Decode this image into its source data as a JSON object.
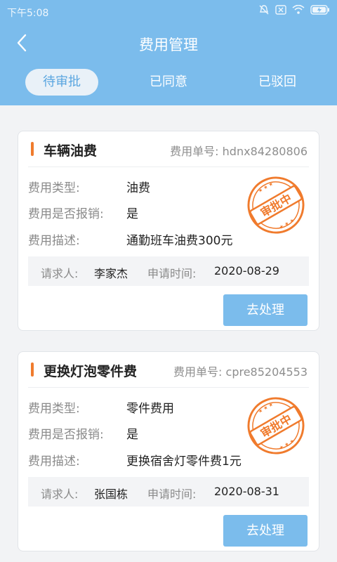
{
  "status": {
    "time": "下午5:08"
  },
  "header": {
    "title": "费用管理",
    "tabs": [
      {
        "label": "待审批",
        "active": true
      },
      {
        "label": "已同意",
        "active": false
      },
      {
        "label": "已驳回",
        "active": false
      }
    ]
  },
  "labels": {
    "expense_no": "费用单号:",
    "type": "费用类型:",
    "reimburse": "费用是否报销:",
    "description": "费用描述:",
    "requester": "请求人:",
    "apply_time": "申请时间:",
    "process_button": "去处理"
  },
  "cards": [
    {
      "title": "车辆油费",
      "expense_no": "hdnx84280806",
      "type": "油费",
      "reimburse": "是",
      "description": "通勤班车油费300元",
      "requester": "李家杰",
      "apply_time": "2020-08-29",
      "stamp": "审批中"
    },
    {
      "title": "更换灯泡零件费",
      "expense_no": "cpre85204553",
      "type": "零件费用",
      "reimburse": "是",
      "description": "更换宿舍灯零件费1元",
      "requester": "张国栋",
      "apply_time": "2020-08-31",
      "stamp": "审批中"
    }
  ],
  "colors": {
    "primary": "#7bbcec",
    "accent": "#f07b2d",
    "stamp": "#f07b2d"
  }
}
